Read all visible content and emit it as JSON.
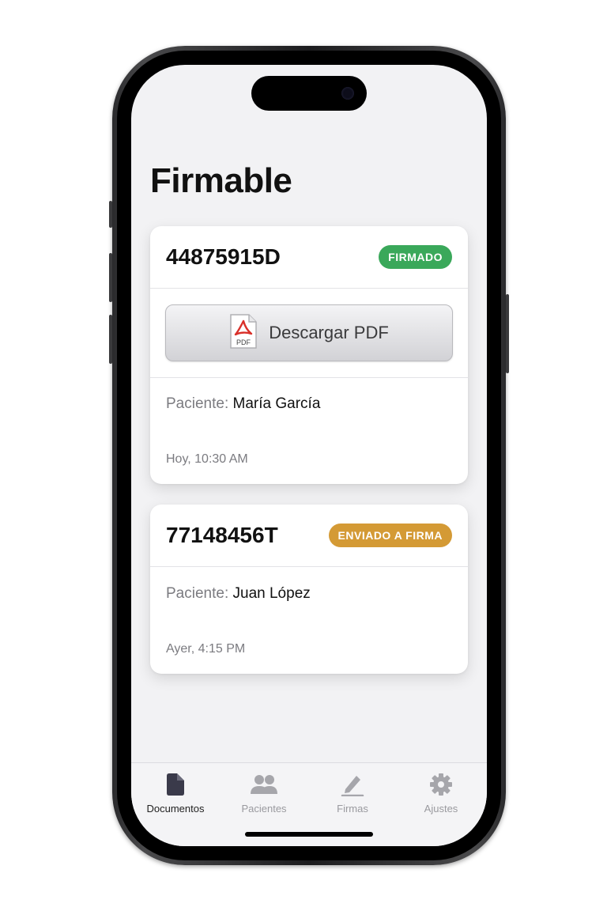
{
  "app": {
    "title": "Firmable"
  },
  "documents": [
    {
      "id": "44875915D",
      "status": "FIRMADO",
      "status_color": "#3aa85a",
      "download_label": "Descargar PDF",
      "pdf_icon_text": "PDF",
      "patient_label": "Paciente:",
      "patient_name": "María García",
      "timestamp": "Hoy, 10:30 AM"
    },
    {
      "id": "77148456T",
      "status": "ENVIADO A FIRMA",
      "status_color": "#d49a35",
      "patient_label": "Paciente:",
      "patient_name": "Juan López",
      "timestamp": "Ayer, 4:15 PM"
    }
  ],
  "tabbar": {
    "active": "Documentos",
    "items": [
      {
        "label": "Documentos",
        "icon": "document-icon"
      },
      {
        "label": "Pacientes",
        "icon": "people-icon"
      },
      {
        "label": "Firmas",
        "icon": "pen-icon"
      },
      {
        "label": "Ajustes",
        "icon": "gear-icon"
      }
    ]
  }
}
